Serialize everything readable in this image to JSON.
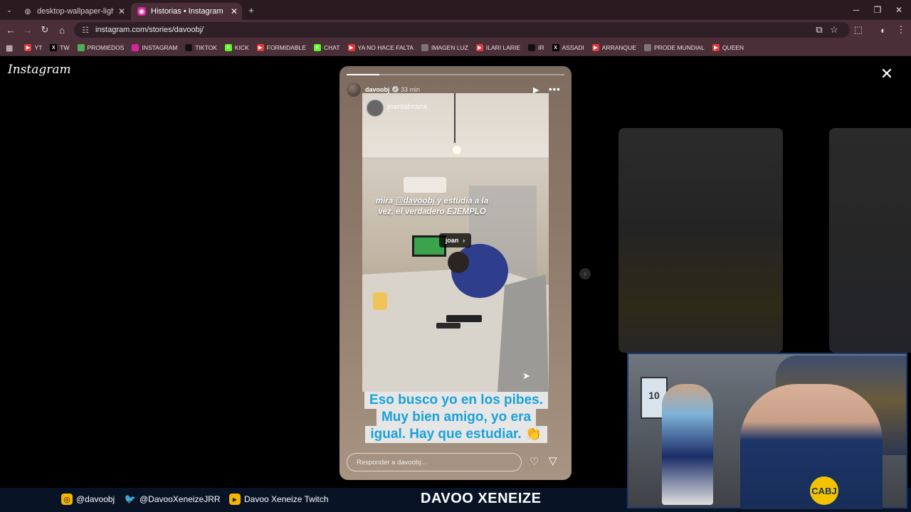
{
  "browser": {
    "tabs": [
      {
        "title": "desktop-wallpaper-light-yellow",
        "icon": "globe-icon",
        "active": false
      },
      {
        "title": "Historias • Instagram",
        "icon": "instagram-icon",
        "active": true
      }
    ],
    "new_tab": "+",
    "url": "instagram.com/stories/davoobj/",
    "bookmarks": [
      {
        "label": "YT",
        "icon": "youtube-icon",
        "color": "#e53935"
      },
      {
        "label": "TW",
        "icon": "x-icon",
        "color": "#000000"
      },
      {
        "label": "PROMIEDOS",
        "icon": "promiedos-icon",
        "color": "#4caf50"
      },
      {
        "label": "INSTAGRAM",
        "icon": "instagram-icon",
        "color": "#d6249f"
      },
      {
        "label": "TIKTOK",
        "icon": "tiktok-icon",
        "color": "#111111"
      },
      {
        "label": "KICK",
        "icon": "kick-icon",
        "color": "#53fc18"
      },
      {
        "label": "FORMIDABLE",
        "icon": "youtube-icon",
        "color": "#e53935"
      },
      {
        "label": "CHAT",
        "icon": "kick-icon",
        "color": "#53fc18"
      },
      {
        "label": "YA NO HACE FALTA",
        "icon": "youtube-icon",
        "color": "#e53935"
      },
      {
        "label": "IMAGEN LUZ",
        "icon": "globe-icon",
        "color": "#777777"
      },
      {
        "label": "ILARI LARIE",
        "icon": "youtube-icon",
        "color": "#e53935"
      },
      {
        "label": "IR",
        "icon": "mk-icon",
        "color": "#111111"
      },
      {
        "label": "ASSADI",
        "icon": "x-icon",
        "color": "#000000"
      },
      {
        "label": "ARRANQUE",
        "icon": "youtube-icon",
        "color": "#e53935"
      },
      {
        "label": "PRODE MUNDIAL",
        "icon": "globe-icon",
        "color": "#777777"
      },
      {
        "label": "QUEEN",
        "icon": "youtube-icon",
        "color": "#e53935"
      }
    ]
  },
  "instagram": {
    "logo": "Instagram",
    "story": {
      "username": "davoobj",
      "time_ago": "33 min",
      "progress": 0.15,
      "reposted_from": "joanlabrana_",
      "caption_prefix": "mira ",
      "caption_mention": "@davoobj",
      "caption_rest": " y estudia a la vez, el verdadero EJEMPLO",
      "tag_label": "joan",
      "sticker_lines": [
        "Eso busco yo en los pibes.",
        "Muy bien amigo, yo era",
        "igual. Hay que estudiar. 👏"
      ],
      "reply_placeholder": "Responder a davoobj..."
    }
  },
  "overlay": {
    "socials": [
      {
        "handle": "@davoobj",
        "icon": "instagram-icon"
      },
      {
        "handle": "@DavooXeneizeJRR",
        "icon": "twitter-icon"
      },
      {
        "handle": "Davoo Xeneize Twitch",
        "icon": "youtube-icon"
      }
    ],
    "brand": "DAVOO XENEIZE",
    "webcam_jersey_number": "10",
    "webcam_logo": "CABJ"
  }
}
